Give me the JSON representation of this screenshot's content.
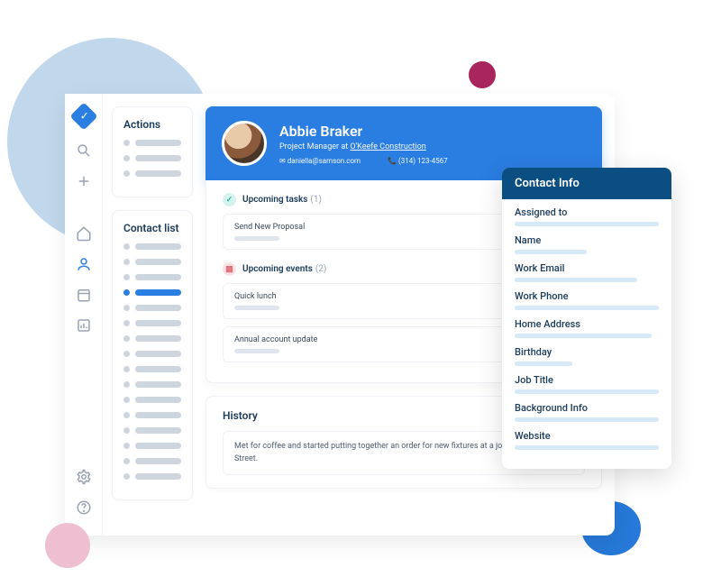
{
  "panels": {
    "actions_title": "Actions",
    "contact_list_title": "Contact list",
    "history_title": "History"
  },
  "contact": {
    "name": "Abbie Braker",
    "role_prefix": "Project Manager at ",
    "company": "O'Keefe Construction",
    "email": "daniella@samson.com",
    "phone": "(314) 123-4567"
  },
  "sections": {
    "tasks": {
      "label": "Upcoming tasks",
      "count": "(1)",
      "items": [
        "Send New Proposal"
      ]
    },
    "events": {
      "label": "Upcoming events",
      "count": "(2)",
      "items": [
        "Quick lunch",
        "Annual account update"
      ]
    }
  },
  "history": {
    "note": "Met for coffee and started putting together an order for new fixtures at a job site on East Main Street."
  },
  "info_card": {
    "title": "Contact Info",
    "fields": [
      "Assigned to",
      "Name",
      "Work Email",
      "Work Phone",
      "Home Address",
      "Birthday",
      "Job Title",
      "Background Info",
      "Website"
    ]
  }
}
